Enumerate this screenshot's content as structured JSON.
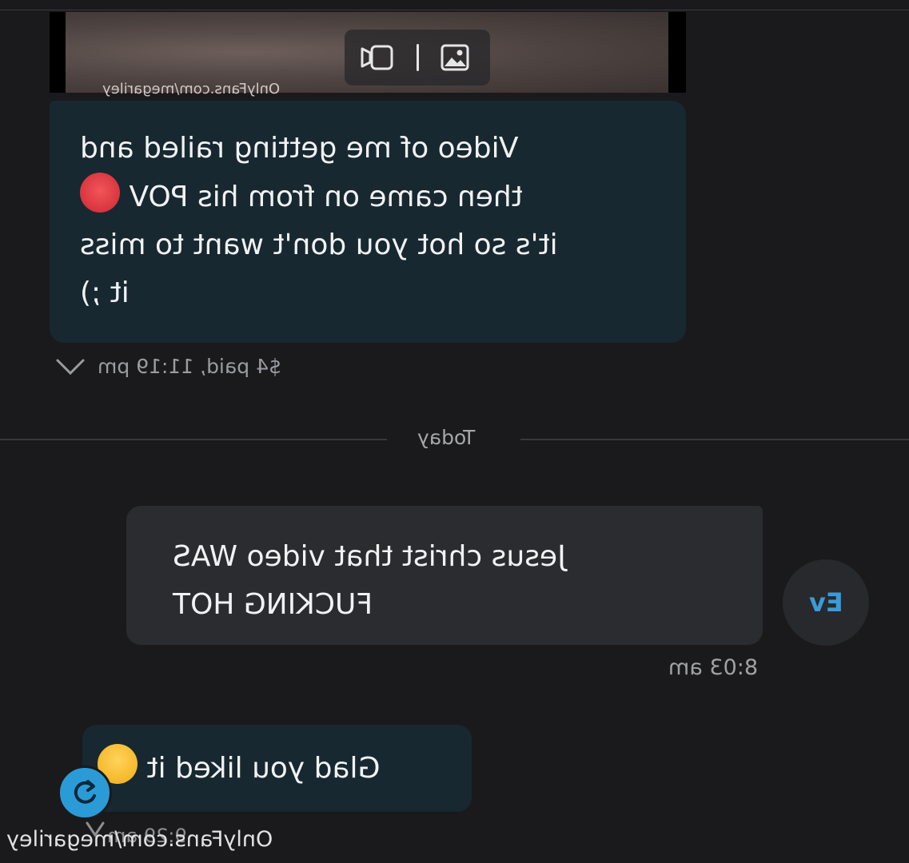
{
  "media": {
    "watermark": "OnlyFans.com/megariley",
    "video_icon": "video-camera-icon",
    "image_icon": "image-icon"
  },
  "messages": [
    {
      "direction": "incoming",
      "text": "Video of me getting railed and then came on from his POV 🥵 it's so hot you don't want to miss it ;)",
      "lines": [
        "Video of me getting railed and",
        "then came on from his POV",
        "it's so hot you don't want to miss",
        "it ;)"
      ],
      "meta": "$4 paid, 11:19 pm"
    },
    {
      "direction": "outgoing",
      "lines": [
        "Jesus christ that video WAS",
        "FUCKING HOT"
      ],
      "time": "8:03 am",
      "avatar_initials": "Ev"
    },
    {
      "direction": "incoming",
      "lines": [
        "Glad you liked it"
      ],
      "time": "9:29 am"
    }
  ],
  "day_divider": "Today",
  "footer_watermark": "OnlyFans.com/megariley",
  "colors": {
    "background": "#1a1a1c",
    "incoming_bubble": "#172830",
    "outgoing_bubble": "#2b2c2f",
    "accent": "#2b9bd8"
  }
}
